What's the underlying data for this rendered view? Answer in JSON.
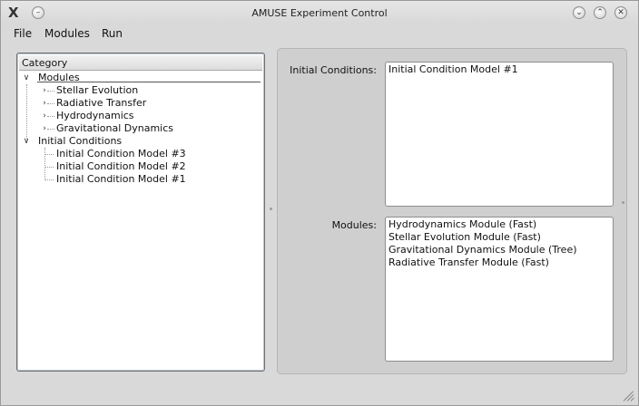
{
  "window": {
    "title": "AMUSE Experiment Control",
    "app_icon_glyph": "X"
  },
  "menubar": {
    "file": "File",
    "modules": "Modules",
    "run": "Run"
  },
  "tree": {
    "header": "Category",
    "modules_label": "Modules",
    "module_children": [
      "Stellar Evolution",
      "Radiative Transfer",
      "Hydrodynamics",
      "Gravitational Dynamics"
    ],
    "initial_conditions_label": "Initial Conditions",
    "ic_children": [
      "Initial Condition Model #3",
      "Initial Condition Model #2",
      "Initial Condition Model #1"
    ]
  },
  "detail": {
    "initial_conditions_label": "Initial Conditions:",
    "initial_conditions_items": [
      "Initial Condition Model #1"
    ],
    "modules_label": "Modules:",
    "modules_items": [
      "Hydrodynamics Module (Fast)",
      "Stellar Evolution Module (Fast)",
      "Gravitational Dynamics Module (Tree)",
      "Radiative Transfer Module (Fast)"
    ]
  },
  "icons": {
    "expand_closed": "chevron-right-icon",
    "expand_open": "chevron-down-icon",
    "minimize": "chevron-down-icon",
    "maximize": "chevron-up-icon",
    "close": "close-icon"
  },
  "colors": {
    "window_bg": "#d9d9d9",
    "panel_bg": "#cfcfcf",
    "list_bg": "#ffffff"
  }
}
